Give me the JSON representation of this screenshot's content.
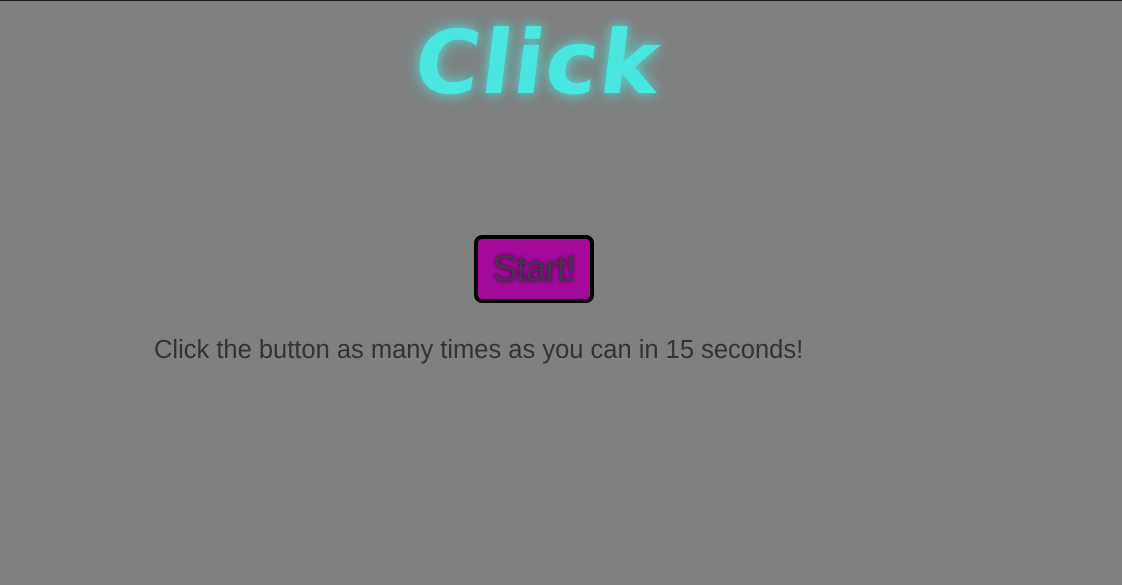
{
  "page": {
    "title": "Click",
    "start_button_label": "Start!",
    "instructions": "Click the button as many times as you can in 15 seconds!"
  },
  "colors": {
    "background": "#808080",
    "title_accent": "#4ae6e0",
    "button_fill": "#a30a9c",
    "button_border": "#000000",
    "text": "#333333"
  }
}
